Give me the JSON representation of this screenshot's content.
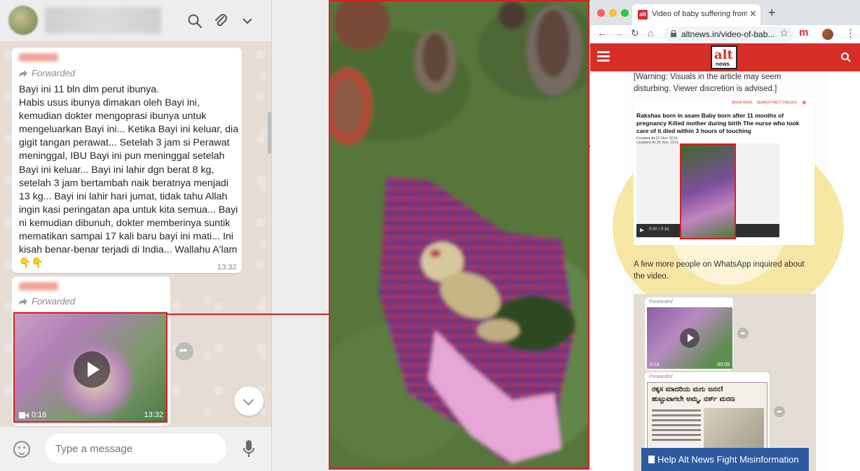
{
  "whatsapp": {
    "input_placeholder": "Type a message",
    "messages": [
      {
        "forwarded_label": "Forwarded",
        "text": "Bayi ini 11 bln dlm perut ibunya.\nHabis usus ibunya dimakan oleh Bayi ini, kemudian dokter mengoprasi ibunya untuk mengeluarkan Bayi ini... Ketika Bayi ini keluar, dia gigit tangan perawat... Setelah 3 jam si Perawat meninggal, IBU Bayi ini pun meninggal setelah Bayi ini keluar... Bayi ini lahir dgn berat 8 kg, setelah 3 jam bertambah naik beratnya menjadi 13 kg... Bayi ini lahir hari jumat, tidak tahu Allah ingin kasi peringatan apa untuk kita semua... Bayi ni kemudian dibunuh, dokter memberinya suntik mematikan sampai 17 kali baru bayi ini mati... Ini kisah benar-benar terjadi di India... Wallahu A'lam",
        "emoji": "👇👇",
        "time": "13:32"
      },
      {
        "forwarded_label": "Forwarded",
        "video_duration": "0:16",
        "time": "13:32"
      }
    ]
  },
  "browser": {
    "tab_title": "Video of baby suffering from rare",
    "tab_favicon": "alt",
    "url": "altnews.in/video-of-bab...",
    "ext_label": "m",
    "site_logo_top": "alt",
    "site_logo_bottom": "news",
    "warning_text": "[Warning: Visuals in the article may seem disturbing. Viewer discretion is advised.]",
    "card": {
      "icon_labels": [
        "MOVE BACK",
        "SEARCH FACT CHECKS"
      ],
      "title": "Rakshas born in asam Baby born after 11 months of pregnancy Killed mother during birth The nurse who took care of it died within 3 hours of touching",
      "created": "Created At:22 Nov 2019",
      "updated": "Updated At:25 Nov 2019",
      "player_time": "0:00 / 0:16"
    },
    "more_text": "A few more people on WhatsApp inquired about the video.",
    "shot": {
      "forwarded_label": "Forwarded",
      "video_duration": "0:16",
      "video_time": "00:09",
      "news_headline_1": "ರಕ್ಕಸ ಮಾದರಿಯ ಮಗು ಜನನ!",
      "news_headline_2": "ಹುಟ್ಟುವಾಗಲೇ ಅಮ್ಮ, ನರ್ಸ್ ಮರಣ"
    },
    "cta_label": "Help Alt News Fight Misinformation"
  },
  "colors": {
    "highlight": "#d91f1f",
    "altnews_red": "#d62e26",
    "cta_blue": "#2c5aa0",
    "whatsapp_bg": "#e5ddd5"
  }
}
